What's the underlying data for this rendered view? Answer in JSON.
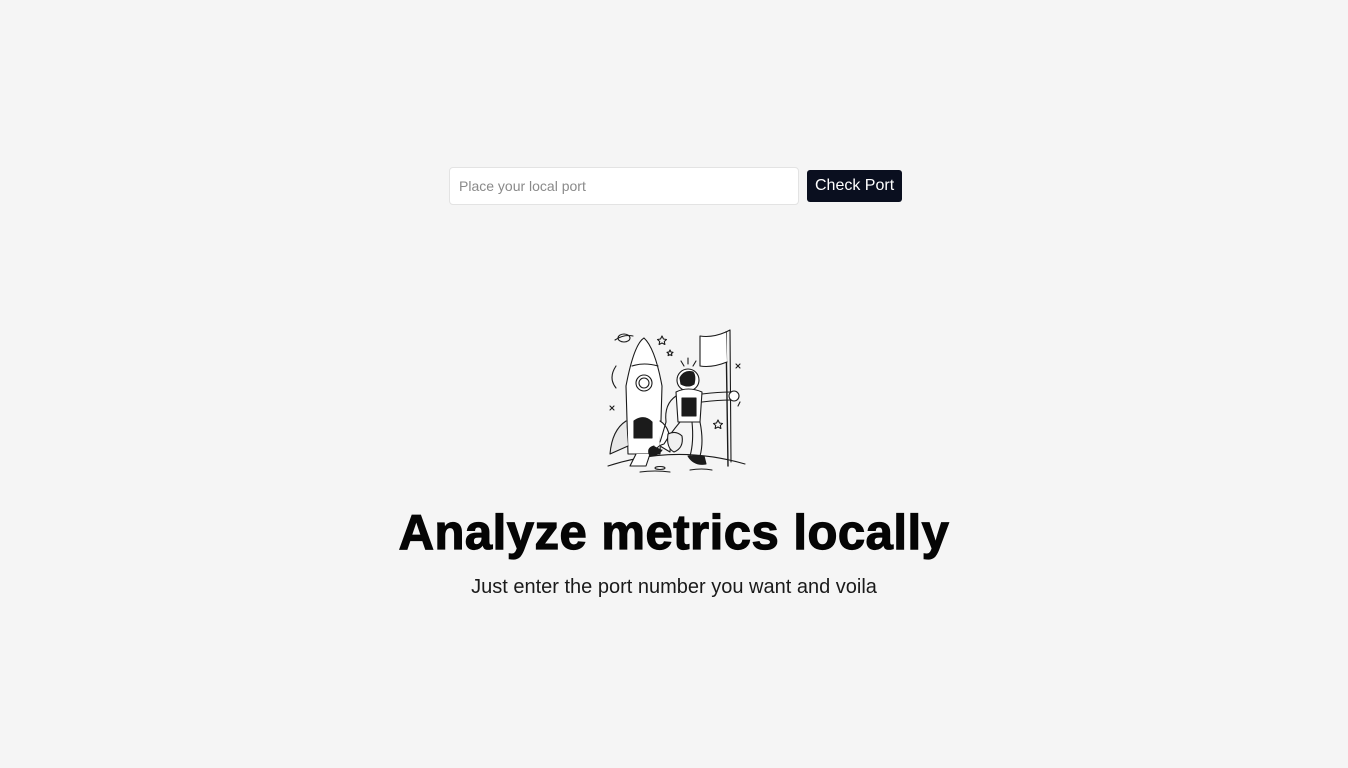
{
  "form": {
    "input_value": "",
    "input_placeholder": "Place your local port",
    "button_label": "Check Port"
  },
  "hero": {
    "illustration_icon": "astronaut-rocket-flag-illustration",
    "title": "Analyze metrics locally",
    "subtitle": "Just enter the port number you want and voila"
  },
  "colors": {
    "background": "#f5f5f5",
    "button_bg": "#0a0f1f",
    "button_text": "#ffffff"
  }
}
